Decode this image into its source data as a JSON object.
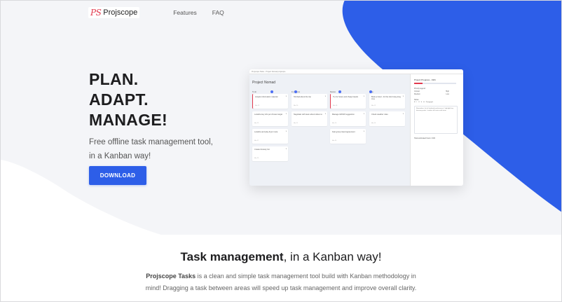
{
  "nav": {
    "logo_mark": "PS",
    "logo_text": "Projscope",
    "links": [
      "Features",
      "FAQ"
    ]
  },
  "hero": {
    "headline": [
      "PLAN.",
      "ADAPT.",
      "MANAGE!"
    ],
    "tagline": "Free offline task management tool, in a Kanban way!",
    "download_label": "DOWNLOAD"
  },
  "app_preview": {
    "window_title": "Projscope Tasks - Project Nomad.projscope",
    "project_title": "Project Nomad",
    "columns": [
      {
        "name": "To do",
        "cards": [
          {
            "text": "Acquire information material",
            "meta": "Mar 22",
            "accent": true
          },
          {
            "text": "Localize key info per chosen target",
            "meta": "Mar 25",
            "accent": false
          },
          {
            "text": "Localize and play dryer route",
            "meta": "Mar 27",
            "accent": false
          },
          {
            "text": "Create itinerary list",
            "meta": "Mar 29",
            "accent": false
          }
        ]
      },
      {
        "name": "In progress",
        "cards": [
          {
            "text": "Tell dad about the trip",
            "meta": "Mar 20",
            "accent": false
          },
          {
            "text": "Negotiate with team about where to",
            "meta": "Mar 21",
            "accent": false
          }
        ]
      },
      {
        "name": "Review",
        "cards": [
          {
            "text": "Try for future and cheap travels",
            "meta": "Mar 18",
            "accent": true
          },
          {
            "text": "Manage GROW suggestion",
            "meta": "Mar 19",
            "accent": false
          },
          {
            "text": "Fast group travel agreement",
            "meta": "Mar 24",
            "accent": false
          }
        ]
      },
      {
        "name": "Done",
        "cards": [
          {
            "text": "Book a hotel - for the short stay-long time",
            "meta": "Mar 12",
            "accent": false
          },
          {
            "text": "Check weather rules",
            "meta": "Mar 14",
            "accent": false
          }
        ]
      }
    ],
    "side": {
      "title": "Project Progress - 19%",
      "priority_label": "Priority legend",
      "priorities": [
        [
          "Critical",
          "High"
        ],
        [
          "Medium",
          "Low"
        ]
      ],
      "notes_label": "Notes",
      "notes_toolbar": [
        "B",
        "I",
        "U",
        "S",
        "H",
        "Paragraph"
      ],
      "notes_text": "Remember: list of landmark preferences / highlight key itinerary points / confirm all routes with team",
      "footer": "Total estimated hours: 19%"
    }
  },
  "section": {
    "title_bold": "Task management",
    "title_rest": ", in a Kanban way!",
    "desc_bold": "Projscope Tasks",
    "desc_rest": " is a clean and simple task management tool build with Kanban methodology in mind! Dragging a task between areas will speed up task management and improve overall clarity."
  },
  "colors": {
    "accent_blue": "#2d5ee8",
    "brand_red": "#e23a4e",
    "hero_bg": "#f4f5f8"
  }
}
